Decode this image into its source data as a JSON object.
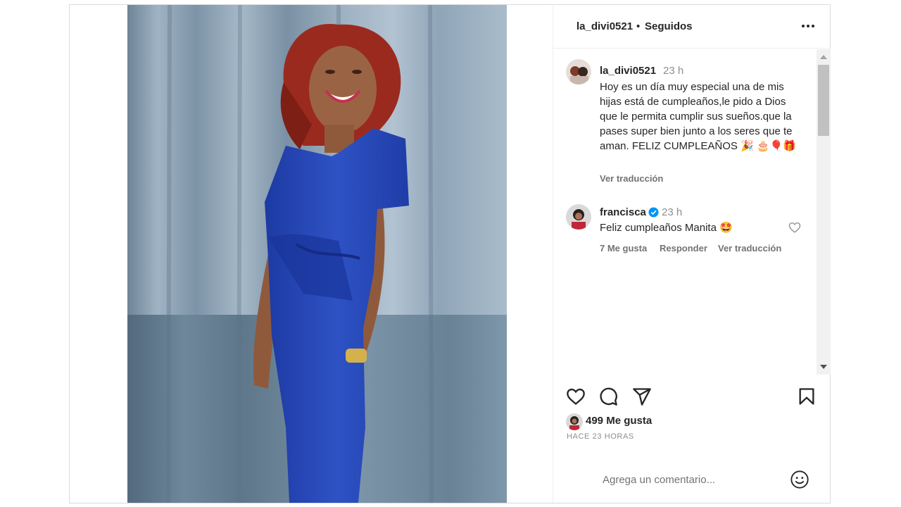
{
  "post": {
    "username": "la_divi0521",
    "separator": "•",
    "follow_status": "Seguidos"
  },
  "caption": {
    "username": "la_divi0521",
    "time": "23 h",
    "text": "Hoy es un día muy especial una de mis hijas está de cumpleaños,le pido a Dios que le permita cumplir sus sueños.que la pases super bien junto a los seres que te aman. FELIZ CUMPLEAÑOS 🎉 🎂🎈🎁",
    "translate": "Ver traducción"
  },
  "comment": {
    "username": "francisca",
    "time": "23 h",
    "text": "Feliz cumpleaños Manita 🤩",
    "likes": "7 Me gusta",
    "reply": "Responder",
    "translate": "Ver traducción"
  },
  "stats": {
    "likes": "499 Me gusta",
    "ago": "HACE 23 HORAS"
  },
  "composer": {
    "placeholder": "Agrega un comentario..."
  },
  "icons": [
    "more-icon",
    "heart-icon",
    "comment-icon",
    "share-icon",
    "bookmark-icon",
    "verified-icon",
    "emoji-icon"
  ],
  "colors": {
    "verified": "#0095f6",
    "dress": "#2a4bb8",
    "curtain": "#8aa1b4",
    "hair": "#9b2a1e"
  }
}
